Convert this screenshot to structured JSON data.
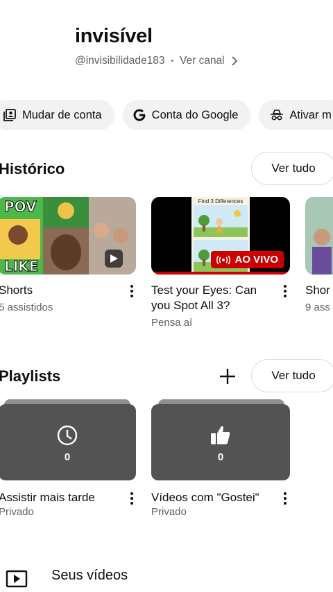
{
  "profile": {
    "name": "invisível",
    "handle": "@invisibilidade183",
    "separator": "•",
    "view_channel": "Ver canal"
  },
  "chips": [
    {
      "label": "Mudar de conta",
      "icon": "switch-account-icon"
    },
    {
      "label": "Conta do Google",
      "icon": "google-g-icon"
    },
    {
      "label": "Ativar m",
      "icon": "incognito-icon"
    }
  ],
  "history": {
    "title": "Histórico",
    "see_all": "Ver tudo",
    "items": [
      {
        "title": "Shorts",
        "subtitle": "5 assistidos",
        "thumb_text_top": "POV",
        "thumb_text_bottom": "LIKE"
      },
      {
        "title": "Test your Eyes: Can you Spot All 3?",
        "subtitle": "Pensa aí",
        "thumb_caption": "Find 3 Differences",
        "badge": "AO VIVO"
      },
      {
        "title": "Shor",
        "subtitle": "9 ass"
      }
    ]
  },
  "playlists": {
    "title": "Playlists",
    "see_all": "Ver tudo",
    "items": [
      {
        "title": "Assistir mais tarde",
        "privacy": "Privado",
        "count": "0",
        "icon": "clock-icon"
      },
      {
        "title": "Vídeos com \"Gostei\"",
        "privacy": "Privado",
        "count": "0",
        "icon": "thumbs-up-icon"
      }
    ]
  },
  "bottom": {
    "your_videos": "Seus vídeos"
  },
  "colors": {
    "live_red": "#cc0000",
    "secondary_text": "#606060",
    "chip_bg": "#f2f2f2",
    "playlist_bg": "#535353"
  }
}
